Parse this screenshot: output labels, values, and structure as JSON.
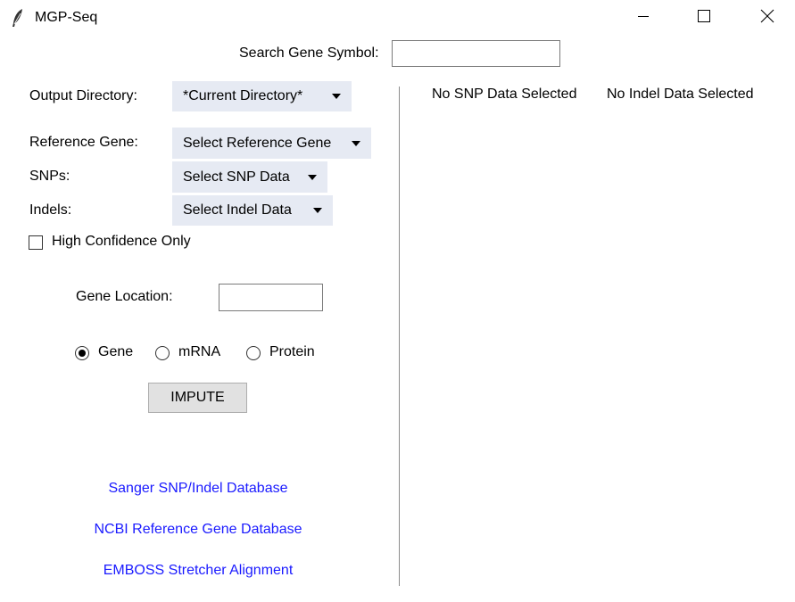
{
  "window": {
    "title": "MGP-Seq",
    "app_icon": "feather-icon",
    "controls": [
      "minimize-icon",
      "maximize-icon",
      "close-icon"
    ]
  },
  "search": {
    "label": "Search Gene Symbol:",
    "value": ""
  },
  "output_directory": {
    "label": "Output Directory:",
    "selected": "*Current Directory*"
  },
  "reference_gene": {
    "label": "Reference Gene:",
    "selected": "Select Reference Gene"
  },
  "snps": {
    "label": "SNPs:",
    "selected": "Select SNP Data"
  },
  "indels": {
    "label": "Indels:",
    "selected": "Select Indel Data"
  },
  "high_confidence": {
    "label": "High Confidence Only",
    "checked": false
  },
  "gene_location": {
    "label": "Gene Location:",
    "value": ""
  },
  "sequence_type": {
    "options": [
      "Gene",
      "mRNA",
      "Protein"
    ],
    "selected": "Gene"
  },
  "impute_button": {
    "label": "IMPUTE"
  },
  "links": {
    "sanger": "Sanger SNP/Indel Database",
    "ncbi": "NCBI Reference Gene Database",
    "emboss": "EMBOSS Stretcher Alignment"
  },
  "status": {
    "snp": "No SNP Data Selected",
    "indel": "No Indel Data Selected"
  },
  "colors": {
    "menu_bg": "#e6eaf3",
    "link": "#1a1aff",
    "button_bg": "#e1e1e1"
  }
}
